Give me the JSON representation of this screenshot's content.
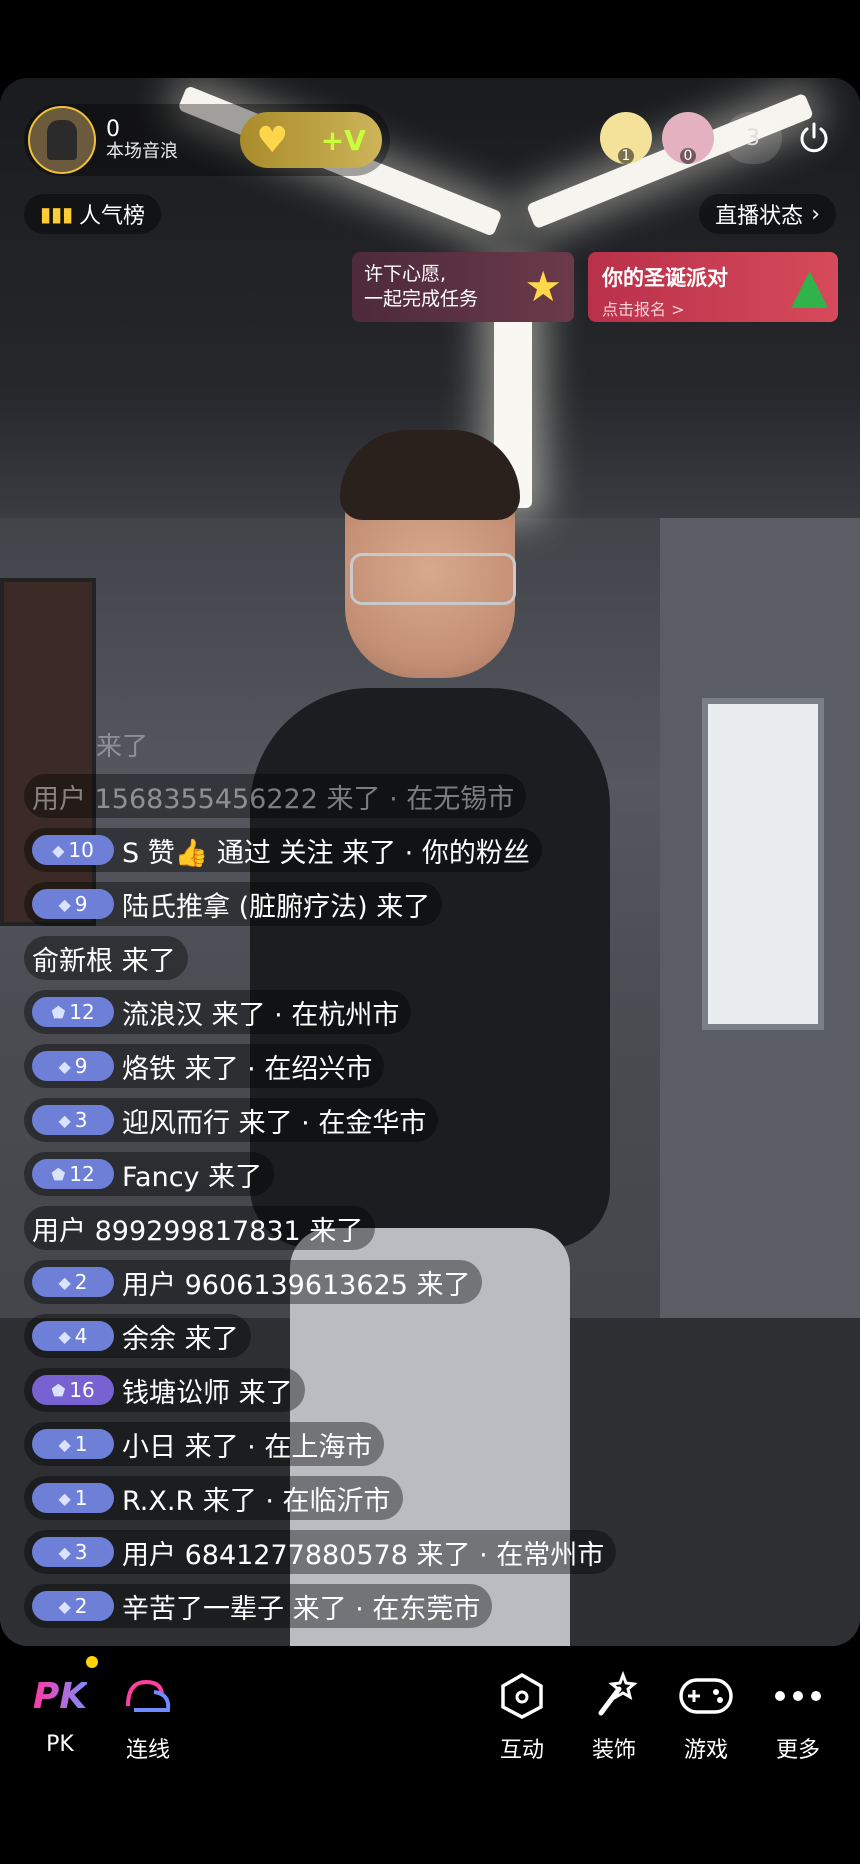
{
  "header": {
    "sound_count": "0",
    "sound_label": "本场音浪",
    "viewer_avatars": [
      {
        "count": "1"
      },
      {
        "count": "0"
      }
    ],
    "online_count": "3",
    "popularity_rank": "人气榜",
    "live_status": "直播状态"
  },
  "banners": {
    "wish_line1": "许下心愿,",
    "wish_line2": "一起完成任务",
    "christmas_title": "你的圣诞派对",
    "christmas_sub": "点击报名 >"
  },
  "chat": {
    "faded_line": "来了",
    "messages": [
      {
        "text": "用户 1568355456222 来了 · 在无锡市",
        "badge": ""
      },
      {
        "badge": "10",
        "text": "S 赞👍 通过 关注 来了 · 你的粉丝"
      },
      {
        "badge": "9",
        "text": "陆氏推拿 (脏腑疗法) 来了"
      },
      {
        "badge": "",
        "text": "俞新根 来了"
      },
      {
        "badge": "12",
        "text": "流浪汉 来了 · 在杭州市"
      },
      {
        "badge": "9",
        "text": "烙铁 来了 · 在绍兴市"
      },
      {
        "badge": "3",
        "text": "迎风而行 来了 · 在金华市"
      },
      {
        "badge": "12",
        "text": "Fancy 来了"
      },
      {
        "badge": "",
        "text": "用户 899299817831 来了"
      },
      {
        "badge": "2",
        "text": "用户 9606139613625 来了"
      },
      {
        "badge": "4",
        "text": "余余 来了"
      },
      {
        "badge": "16",
        "text": "钱塘讼师 来了"
      },
      {
        "badge": "1",
        "text": "小日 来了 · 在上海市"
      },
      {
        "badge": "1",
        "text": "R.X.R 来了 · 在临沂市"
      },
      {
        "badge": "3",
        "text": "用户 6841277880578 来了 · 在常州市"
      },
      {
        "badge": "2",
        "text": "辛苦了一辈子 来了 · 在东莞市"
      }
    ]
  },
  "toolbar": {
    "pk_logo": "PK",
    "pk_label": "PK",
    "link_label": "连线",
    "interact_label": "互动",
    "decor_label": "装饰",
    "game_label": "游戏",
    "more_label": "更多"
  },
  "colors": {
    "accent_pink": "#ff39a6",
    "badge_blue": "#6e7fd8",
    "notification_dot": "#ffd400"
  }
}
